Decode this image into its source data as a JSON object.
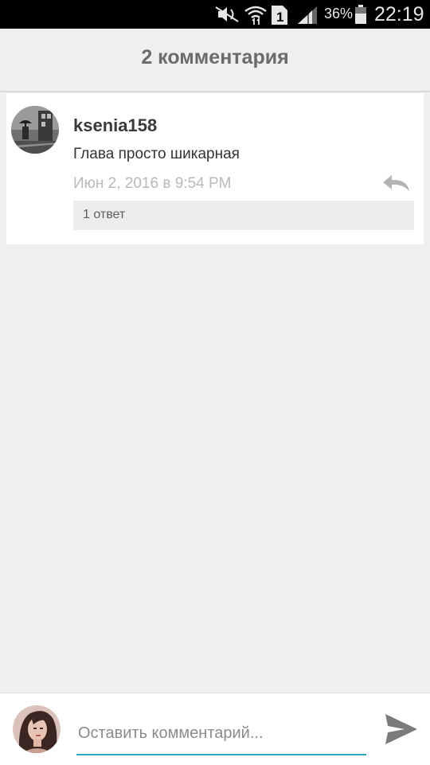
{
  "status_bar": {
    "battery_percent": "36%",
    "time": "22:19",
    "sim_number": "1",
    "icons": [
      "mute-icon",
      "wifi-icon",
      "sim-icon",
      "signal-icon",
      "battery-icon"
    ]
  },
  "header": {
    "title": "2 комментария"
  },
  "comments": [
    {
      "author": "ksenia158",
      "text": "Глава просто шикарная",
      "timestamp": "Июн 2, 2016 в 9:54 PM",
      "replies_label": "1 ответ"
    }
  ],
  "input": {
    "placeholder": "Оставить комментарий..."
  },
  "colors": {
    "accent": "#2aa7b8",
    "background": "#efeef1",
    "timestamp": "#b9b9bb"
  }
}
